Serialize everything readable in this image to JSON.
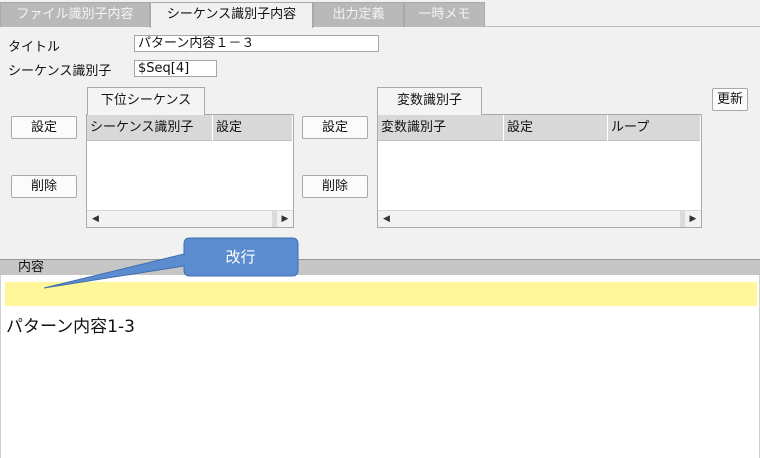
{
  "tabs": [
    {
      "label": "ファイル識別子内容"
    },
    {
      "label": "シーケンス識別子内容"
    },
    {
      "label": "出力定義"
    },
    {
      "label": "一時メモ"
    }
  ],
  "form": {
    "title_label": "タイトル",
    "title_value": "パターン内容１－３",
    "seq_id_label": "シーケンス識別子",
    "seq_id_value": "$Seq[4]"
  },
  "update_button": "更新",
  "lower_sequence": {
    "tab_label": "下位シーケンス",
    "set_button": "設定",
    "delete_button": "削除",
    "columns": [
      "シーケンス識別子",
      "設定"
    ]
  },
  "variables": {
    "tab_label": "変数識別子",
    "set_button": "設定",
    "delete_button": "削除",
    "columns": [
      "変数識別子",
      "設定",
      "ループ"
    ]
  },
  "content_section": {
    "label": "内容",
    "text": "パターン内容1-3"
  },
  "callout": {
    "text": "改行",
    "fill": "#5b8ccf"
  }
}
